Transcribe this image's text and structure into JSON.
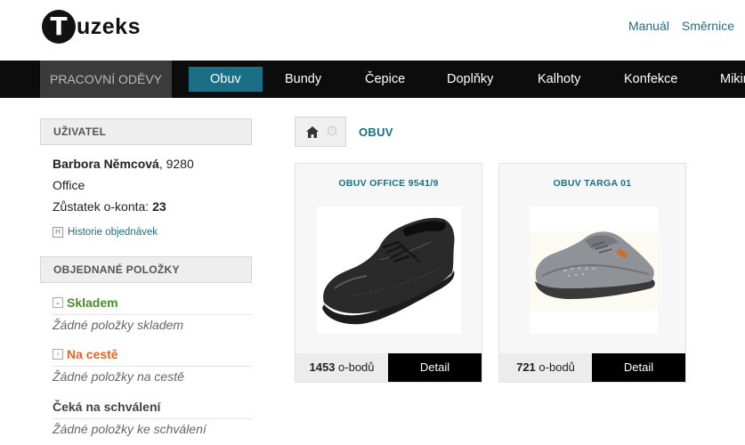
{
  "header": {
    "logo_letter": "T",
    "logo_text": "uzeks",
    "links": [
      "Manuál",
      "Směrnice"
    ]
  },
  "nav": {
    "category": "PRACOVNÍ ODĚVY",
    "items": [
      "Obuv",
      "Bundy",
      "Čepice",
      "Doplňky",
      "Kalhoty",
      "Konfekce",
      "Mikiny"
    ],
    "active_index": 0
  },
  "user_panel": {
    "title": "UŽIVATEL",
    "name": "Barbora Němcová",
    "id_suffix": ", 9280",
    "department": "Office",
    "balance_label": "Zůstatek o-konta:",
    "balance_value": "23",
    "history_icon": "H",
    "history_link": "Historie objednávek"
  },
  "orders_panel": {
    "title": "OBJEDNANÉ POLOŽKY",
    "sections": [
      {
        "title": "Skladem",
        "empty": "Žádné položky skladem",
        "color": "#4a8f2c",
        "icon": "chevron-down-icon"
      },
      {
        "title": "Na cestě",
        "empty": "Žádné položky na cestě",
        "color": "#e0652a",
        "icon": "chevron-right-icon"
      },
      {
        "title": "Čeká na schválení",
        "empty": "Žádné položky ke schválení",
        "color": "#444444",
        "icon": ""
      }
    ]
  },
  "breadcrumb": {
    "current": "OBUV"
  },
  "products": [
    {
      "title": "OBUV OFFICE 9541/9",
      "price": "1453",
      "unit": "o-bodů",
      "button": "Detail",
      "image": "black-oxford-shoe"
    },
    {
      "title": "OBUV TARGA 01",
      "price": "721",
      "unit": "o-bodů",
      "button": "Detail",
      "image": "grey-sneaker-shoe"
    }
  ],
  "colors": {
    "accent": "#1a6f86",
    "nav_bg": "#0c0c0c",
    "nav_category_bg": "#3b3b3b"
  }
}
